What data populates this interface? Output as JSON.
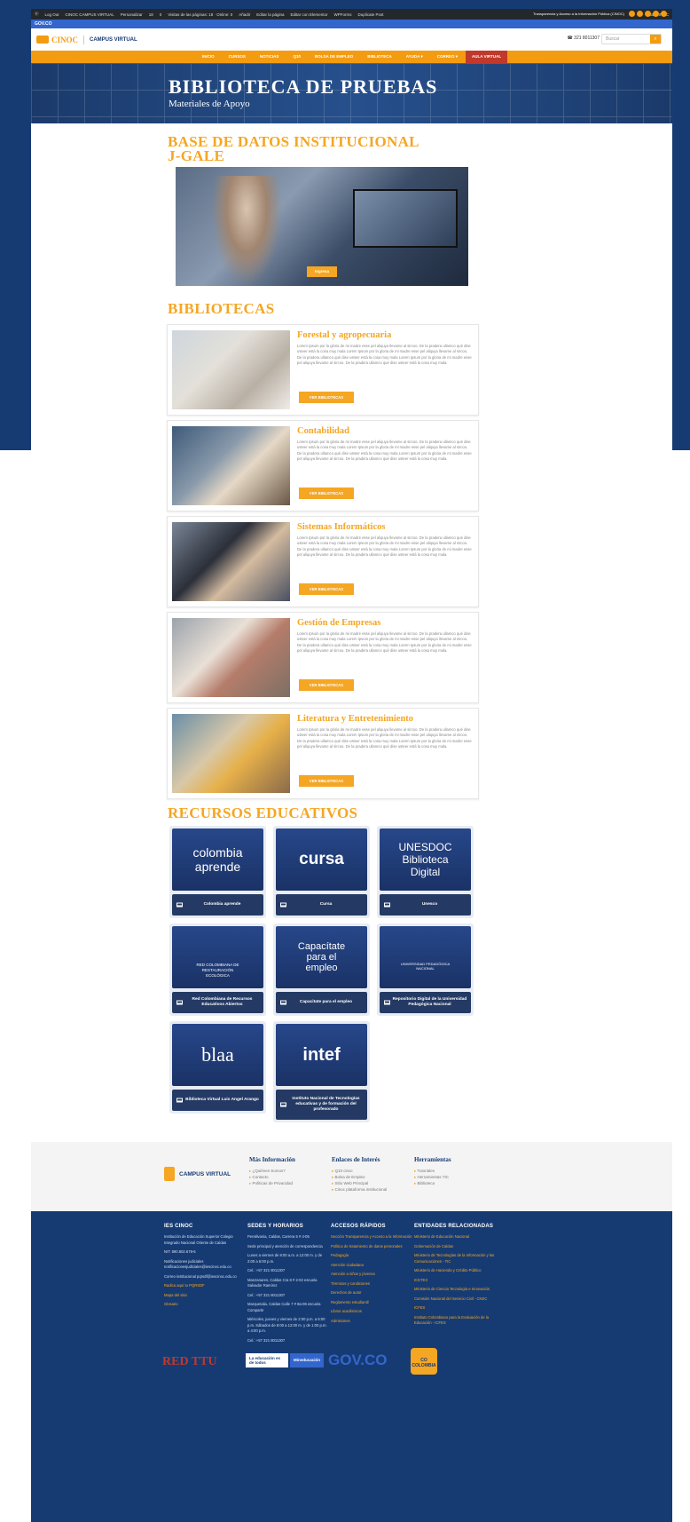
{
  "admin_bar": {
    "items": [
      "Log Out",
      "CINOC CAMPUS VIRTUAL",
      "Personalizar",
      "18",
      "0",
      "Visitas de las páginas: 18 · Online: 0",
      "Añadir",
      "Editar la página",
      "Editar con Elementor",
      "WPForms",
      "Duplicate Post"
    ],
    "greeting": "Hola, CINOC"
  },
  "gov_bar": {
    "label": "GOV.CO"
  },
  "header": {
    "logo": "CINOC",
    "campus": "CAMPUS VIRTUAL",
    "phone": "321 8011307",
    "search_placeholder": "Buscar",
    "transparency": "Transparencia y Acceso a la Información Pública (CINOC)"
  },
  "nav": {
    "items": [
      "INICIO",
      "CURSOS",
      "NOTICIAS",
      "Q10",
      "BOLSA DE EMPLEO",
      "BIBLIOTECA",
      "AYUDA ▾",
      "CORREO ▾",
      "AULA VIRTUAL"
    ]
  },
  "hero": {
    "title": "BIBLIOTECA DE PRUEBAS",
    "subtitle": "Materiales de Apoyo"
  },
  "database": {
    "title_line1": "BASE DE DATOS INSTITUCIONAL",
    "title_line2": "J-GALE",
    "button": "Ingresa"
  },
  "bibliotecas": {
    "title": "BIBLIOTECAS",
    "lorem": "Lorem Ipsum por la gloria de mi madre esse pel aliquya llevame al sircoo. De la pradera ullamco qué dise usteer está la cosa muy mala Lorem Ipsum por la gloria de mi madre esse pel aliquya llevame al sircoo. De la pradera ullamco qué dise usteer está la cosa muy mala Lorem Ipsum por la gloria de mi madre esse pel aliquya llevame al sircoo. De la pradera ullamco qué dise usteer está la cosa muy mala.",
    "button": "VER BIBLIOTECAS",
    "items": [
      "Forestal y agropecuaria",
      "Contabilidad",
      "Sistemas Informáticos",
      "Gestión de Empresas",
      "Literatura y Entretenimiento"
    ]
  },
  "recursos": {
    "title": "RECURSOS EDUCATIVOS",
    "items": [
      {
        "logo": "colombia aprende",
        "label": "Colombia aprende"
      },
      {
        "logo": "cursa",
        "label": "Cursa"
      },
      {
        "logo": "UNESDOC Biblioteca Digital",
        "label": "Unesco"
      },
      {
        "logo": "RED COLOMBIANA DE RESTAURACIÓN ECOLÓGICA",
        "label": "Red Colombiana de Recursos Educativos Abiertos"
      },
      {
        "logo": "Capacítate para el empleo",
        "label": "Capacitate para el empleo"
      },
      {
        "logo": "UNIVERSIDAD PEDAGÓGICA NACIONAL",
        "label": "Repositorio Digital de la Universidad Pedagógica Nacional"
      },
      {
        "logo": "blaa",
        "label": "Biblioteca Virtual Luis Angel Arango"
      },
      {
        "logo": "intef",
        "label": "Instituto Nacional de Tecnologías educativas y de formación del profesorado"
      }
    ]
  },
  "footer_top": {
    "logo": "CAMPUS VIRTUAL",
    "cols": [
      {
        "title": "Más Información",
        "items": [
          "¿Quiénes Somos?",
          "Contacto",
          "Políticas de Privacidad"
        ]
      },
      {
        "title": "Enlaces de Interés",
        "items": [
          "Q10 cinoc",
          "Bolsa de Empleo",
          "Sitio Web Principal",
          "Cinoc plataforma institucional"
        ]
      },
      {
        "title": "Herramientas",
        "items": [
          "Tutoriales",
          "Herramientas TIC",
          "Biblioteca"
        ]
      }
    ]
  },
  "footer_bottom": {
    "cols": [
      {
        "title": "IES CINOC",
        "items": [
          {
            "t": "Institución de Educación Superior Colegio Integrado Nacional Oriente de Caldas",
            "o": false
          },
          {
            "t": "NIT: 890.802.678-6",
            "o": false
          },
          {
            "t": "Notificaciones judiciales notificacionesjudiciales@iescinoc.edu.co",
            "o": false
          },
          {
            "t": "Correo institucional pqrsdf@iescinoc.edu.co",
            "o": false
          },
          {
            "t": "Radica aquí tu PQRSDF",
            "o": true
          },
          {
            "t": "Mapa del sitio",
            "o": true
          },
          {
            "t": "Glosario",
            "o": true
          }
        ]
      },
      {
        "title": "SEDES Y HORARIOS",
        "items": [
          {
            "t": "Pensilvania, Caldas, Carrera 5 # 4-05",
            "o": false
          },
          {
            "t": "Sede principal y atención de correspondencia",
            "o": false
          },
          {
            "t": "Lunes a viernes de 8:00 a.m. a 12:00 m. y de 2:00 a 6:00 p.m.",
            "o": false
          },
          {
            "t": "Cel.: +57 321 8011307",
            "o": false
          },
          {
            "t": "Manzanares, Caldas Cra 8 # 2-02 escuela Salvador Ramírez",
            "o": false
          },
          {
            "t": "Cel.: +57 321 8011307",
            "o": false
          },
          {
            "t": "Marquetalia, Caldas Calle 7 # 8a-06 escuela Compartir",
            "o": false
          },
          {
            "t": "Miércoles, jueves y viernes de 2:00 p.m. a 6:00 p.m. Sábados de 8:00 a 12:00 m. y de 1:00 p.m. a 4:00 p.m.",
            "o": false
          },
          {
            "t": "Cel.: +57 321 8011307",
            "o": false
          }
        ]
      },
      {
        "title": "ACCESOS RÁPIDOS",
        "items": [
          {
            "t": "Sección Transparencia y Acceso a la Información",
            "o": true
          },
          {
            "t": "Política de tratamiento de datos personales",
            "o": true
          },
          {
            "t": "Pedagogía",
            "o": true
          },
          {
            "t": "Atención ciudadana",
            "o": true
          },
          {
            "t": "Atención a niños y jóvenes",
            "o": true
          },
          {
            "t": "Términos y condiciones",
            "o": true
          },
          {
            "t": "Derechos de autor",
            "o": true
          },
          {
            "t": "Reglamento estudiantil",
            "o": true
          },
          {
            "t": "Libros académicos",
            "o": true
          },
          {
            "t": "Admisiones",
            "o": true
          }
        ]
      },
      {
        "title": "ENTIDADES RELACIONADAS",
        "items": [
          {
            "t": "Ministerio de Educación Nacional",
            "o": true
          },
          {
            "t": "Gobernación de Caldas",
            "o": true
          },
          {
            "t": "Ministerio de Tecnologías de la Información y las Comunicaciones - TIC",
            "o": true
          },
          {
            "t": "Ministerio de Hacienda y Crédito Público",
            "o": true
          },
          {
            "t": "ICETEX",
            "o": true
          },
          {
            "t": "Ministerio de Ciencia Tecnología e Innovación",
            "o": true
          },
          {
            "t": "Comisión Nacional del Servicio Civil - CNSC",
            "o": true
          },
          {
            "t": "ICFES",
            "o": true
          },
          {
            "t": "Instituto Colombiano para la Evaluación de la Educación - ICFES",
            "o": true
          }
        ]
      }
    ],
    "logos": [
      "RED TTU",
      "La educación es de todos",
      "Mineducación",
      "GOV.CO",
      "CO COLOMBIA"
    ]
  }
}
